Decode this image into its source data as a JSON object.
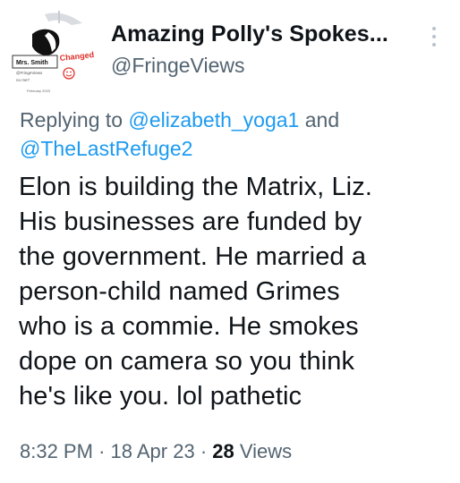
{
  "tweet": {
    "author": {
      "display_name": "Amazing Polly's Spokes...",
      "handle": "@FringeViews",
      "avatar": {
        "name_tag": "Mrs. Smith",
        "changed_text": "Changed",
        "handle_small": "@FringeViews",
        "caption": "no me?",
        "date_small": "February 2023"
      }
    },
    "replying_to": {
      "prefix": "Replying to",
      "mention_1": "@elizabeth_yoga1",
      "joiner": "and",
      "mention_2": "@TheLastRefuge2"
    },
    "text": "Elon is building the Matrix, Liz.\nHis businesses are funded by\nthe government. He married a\nperson-child named Grimes\nwho is a commie. He smokes\ndope on camera so you think\nhe's like you. lol pathetic",
    "time": "8:32 PM",
    "separator": "·",
    "date": "18 Apr 23",
    "views_count": "28",
    "views_label": "Views"
  },
  "colors": {
    "text_primary": "#0f1419",
    "text_secondary": "#536471",
    "link": "#1d9bf0",
    "changed_red": "#e0312b"
  },
  "icons": [
    "more-icon",
    "smiley-icon"
  ]
}
